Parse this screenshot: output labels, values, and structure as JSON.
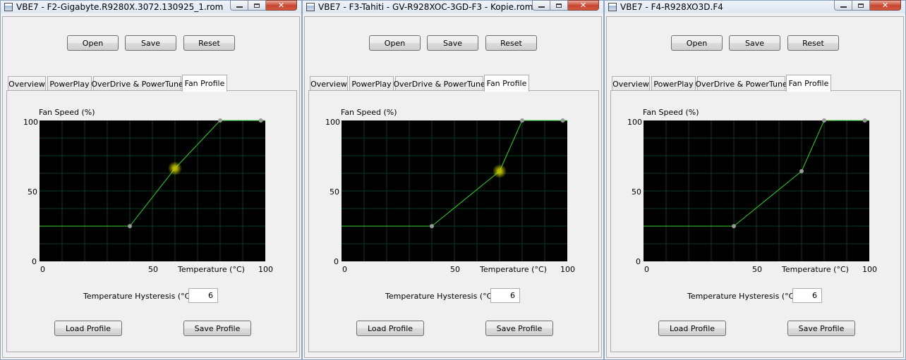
{
  "windows": [
    {
      "title": "VBE7 - F2-Gigabyte.R9280X.3072.130925_1.rom",
      "toolbar": {
        "open": "Open",
        "save": "Save",
        "reset": "Reset"
      },
      "tabs": [
        "Overview",
        "PowerPlay",
        "OverDrive & PowerTune",
        "Fan Profile"
      ],
      "active_tab": "Fan Profile",
      "chart_data": {
        "type": "line",
        "ylabel": "Fan Speed (%)",
        "xlabel": "Temperature (°C)",
        "xlim": [
          0,
          100
        ],
        "ylim": [
          0,
          100
        ],
        "x_ticks": [
          "0",
          "50",
          "100"
        ],
        "y_ticks": [
          "100",
          "50",
          "0"
        ],
        "grid": true,
        "points": [
          [
            0,
            25
          ],
          [
            40,
            25
          ],
          [
            60,
            66
          ],
          [
            80,
            100
          ],
          [
            100,
            100
          ]
        ],
        "handles": [
          [
            40,
            25
          ],
          [
            60,
            66
          ],
          [
            80,
            100
          ],
          [
            98,
            100
          ]
        ],
        "highlight_point": [
          60,
          66
        ],
        "colors": {
          "line": "#35d12b",
          "grid": "#0d3a22",
          "handle": "#9a9a9a",
          "highlight": "#f2ef00"
        }
      },
      "hysteresis": {
        "label": "Temperature Hysteresis (°C)",
        "value": "6"
      },
      "profile": {
        "load": "Load Profile",
        "save": "Save Profile"
      }
    },
    {
      "title": "VBE7 - F3-Tahiti - GV-R928XOC-3GD-F3 - Kopie.rom",
      "toolbar": {
        "open": "Open",
        "save": "Save",
        "reset": "Reset"
      },
      "tabs": [
        "Overview",
        "PowerPlay",
        "OverDrive & PowerTune",
        "Fan Profile"
      ],
      "active_tab": "Fan Profile",
      "chart_data": {
        "type": "line",
        "ylabel": "Fan Speed (%)",
        "xlabel": "Temperature (°C)",
        "xlim": [
          0,
          100
        ],
        "ylim": [
          0,
          100
        ],
        "x_ticks": [
          "0",
          "50",
          "100"
        ],
        "y_ticks": [
          "100",
          "50",
          "0"
        ],
        "grid": true,
        "points": [
          [
            0,
            25
          ],
          [
            40,
            25
          ],
          [
            70,
            64
          ],
          [
            80,
            100
          ],
          [
            100,
            100
          ]
        ],
        "handles": [
          [
            40,
            25
          ],
          [
            70,
            64
          ],
          [
            80,
            100
          ],
          [
            98,
            100
          ]
        ],
        "highlight_point": [
          70,
          64
        ],
        "colors": {
          "line": "#35d12b",
          "grid": "#0d3a22",
          "handle": "#9a9a9a",
          "highlight": "#f2ef00"
        }
      },
      "hysteresis": {
        "label": "Temperature Hysteresis (°C)",
        "value": "6"
      },
      "profile": {
        "load": "Load Profile",
        "save": "Save Profile"
      }
    },
    {
      "title": "VBE7 - F4-R928XO3D.F4",
      "toolbar": {
        "open": "Open",
        "save": "Save",
        "reset": "Reset"
      },
      "tabs": [
        "Overview",
        "PowerPlay",
        "OverDrive & PowerTune",
        "Fan Profile"
      ],
      "active_tab": "Fan Profile",
      "chart_data": {
        "type": "line",
        "ylabel": "Fan Speed (%)",
        "xlabel": "Temperature (°C)",
        "xlim": [
          0,
          100
        ],
        "ylim": [
          0,
          100
        ],
        "x_ticks": [
          "0",
          "50",
          "100"
        ],
        "y_ticks": [
          "100",
          "50",
          "0"
        ],
        "grid": true,
        "points": [
          [
            0,
            25
          ],
          [
            40,
            25
          ],
          [
            70,
            64
          ],
          [
            80,
            100
          ],
          [
            100,
            100
          ]
        ],
        "handles": [
          [
            40,
            25
          ],
          [
            70,
            64
          ],
          [
            80,
            100
          ],
          [
            98,
            100
          ]
        ],
        "highlight_point": null,
        "colors": {
          "line": "#35d12b",
          "grid": "#0d3a22",
          "handle": "#9a9a9a",
          "highlight": "#f2ef00"
        }
      },
      "hysteresis": {
        "label": "Temperature Hysteresis (°C)",
        "value": "6"
      },
      "profile": {
        "load": "Load Profile",
        "save": "Save Profile"
      }
    }
  ]
}
